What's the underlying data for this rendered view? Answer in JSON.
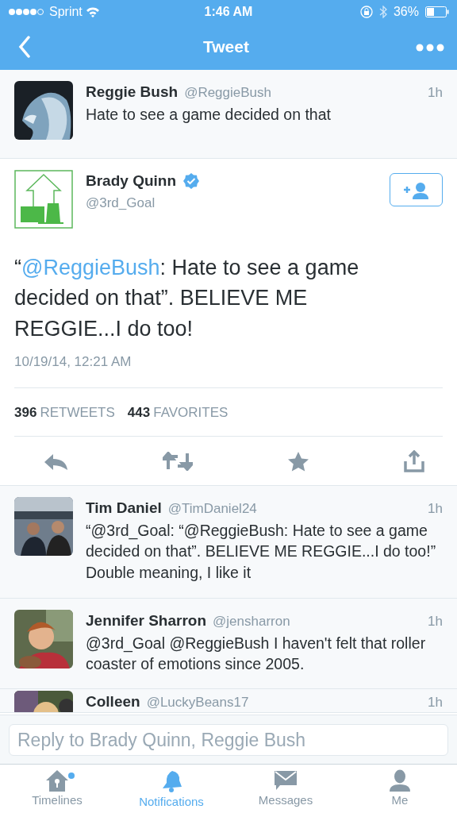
{
  "status_bar": {
    "carrier": "Sprint",
    "time": "1:46 AM",
    "battery": "36%"
  },
  "nav": {
    "title": "Tweet"
  },
  "parent_tweet": {
    "name": "Reggie Bush",
    "handle": "@ReggieBush",
    "time": "1h",
    "text": "Hate to see a game decided on that"
  },
  "main_tweet": {
    "name": "Brady Quinn",
    "verified": true,
    "handle": "@3rd_Goal",
    "following": false,
    "text": [
      {
        "kind": "text",
        "text": "“"
      },
      {
        "kind": "mention",
        "text": "@ReggieBush"
      },
      {
        "kind": "text",
        "text": ": Hate to see a game decided on that”. BELIEVE ME REGGIE...I do too!"
      }
    ],
    "timestamp": "10/19/14, 12:21 AM",
    "stats": [
      {
        "count": "396",
        "label": "RETWEETS"
      },
      {
        "count": "443",
        "label": "FAVORITES"
      }
    ]
  },
  "replies": [
    {
      "name": "Tim Daniel",
      "handle": "@TimDaniel24",
      "time": "1h",
      "text": "“@3rd_Goal: “@ReggieBush: Hate to see a game decided on that”. BELIEVE ME REGGIE...I do too!” Double meaning, I like it"
    },
    {
      "name": "Jennifer Sharron",
      "handle": "@jensharron",
      "time": "1h",
      "text": "@3rd_Goal @ReggieBush I haven't felt that roller coaster of emotions since 2005."
    },
    {
      "name": "Colleen",
      "handle": "@LuckyBeans17",
      "time": "1h"
    }
  ],
  "reply_field": {
    "placeholder": "Reply to Brady Quinn, Reggie Bush"
  },
  "tabs": [
    {
      "label": "Timelines",
      "kind": "home",
      "selected": false,
      "unread": true
    },
    {
      "label": "Notifications",
      "kind": "bell",
      "selected": true,
      "unread": false
    },
    {
      "label": "Messages",
      "kind": "mail",
      "selected": false,
      "unread": false
    },
    {
      "label": "Me",
      "kind": "person",
      "selected": false,
      "unread": false
    }
  ]
}
